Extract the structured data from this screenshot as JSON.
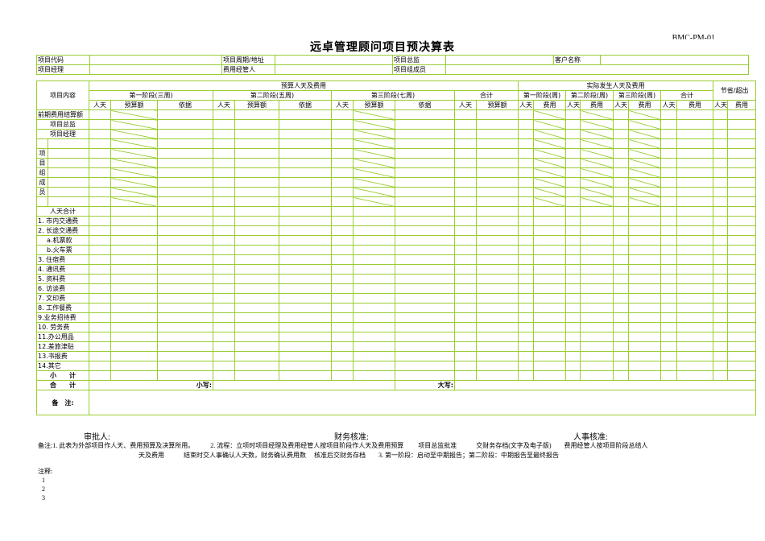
{
  "doc_no": "BMC-PM-01",
  "title": "远卓管理顾问项目预决算表",
  "header": {
    "project_code": "项目代码",
    "project_period": "项目周期/地址",
    "project_director": "项目总监",
    "client_name": "客户名称",
    "project_manager": "项目经理",
    "cost_manager": "费用经管人",
    "team_members": "项目组成员"
  },
  "table": {
    "project_content": "项目内容",
    "budget_group": "预算人天及费用",
    "actual_group": "实际发生人天及费用",
    "saving": "节省/超出",
    "stage1": "第一阶段(三周)",
    "stage2": "第二阶段(五周)",
    "stage3": "第三阶段(七周)",
    "total": "合计",
    "a_stage1": "第一阶段(周)",
    "a_stage2": "第二阶段(周)",
    "a_stage3": "第三阶段(周)",
    "days": "人天",
    "budget_amount": "预算额",
    "basis": "依据",
    "cost": "费用",
    "row_names": [
      "前期费用结算额",
      "项目总监",
      "项目经理"
    ],
    "team_chars": [
      "项",
      "目",
      "组",
      "成",
      "员"
    ],
    "days_total": "人天合计",
    "expense_rows": [
      "1. 市内交通费",
      "2. 长途交通费",
      "a.机票款",
      "b.火车票",
      "3. 住宿费",
      "4. 通讯费",
      "5. 资料费",
      "6. 访谈费",
      "7. 文印费",
      "8. 工作餐费",
      "9.业务招待费",
      "10. 劳务费",
      "11.办公用品",
      "12.差旅津贴",
      "13.书报费",
      "14.其它"
    ],
    "subtotal": "小　　计",
    "grand_total": "合　　计",
    "lower_case": "小写:",
    "upper_case": "大写:",
    "remarks": "备　注:"
  },
  "signatures": {
    "approver": "审批人:",
    "finance": "财务核准:",
    "hr": "人事核准:"
  },
  "remark_text_1": "备注:1. 此表为外部项目作人天、费用预算及决算所用。　　　2. 流程：立项时项目经理及费用经管人按项目阶段作人天及费用预算　　 项目总监批准　　　交财务存档(文字及电子版)　　费用经管人按项目阶段总结人",
  "remark_text_2": "天及费用　　　结束时交人事确认人天数，财务确认费用数　 核准后交财务存档　　3. 第一阶段：启动至中期报告；第二阶段：中期报告至最终报告",
  "notes_title": "注释:",
  "notes": [
    "1",
    "2",
    "3"
  ]
}
